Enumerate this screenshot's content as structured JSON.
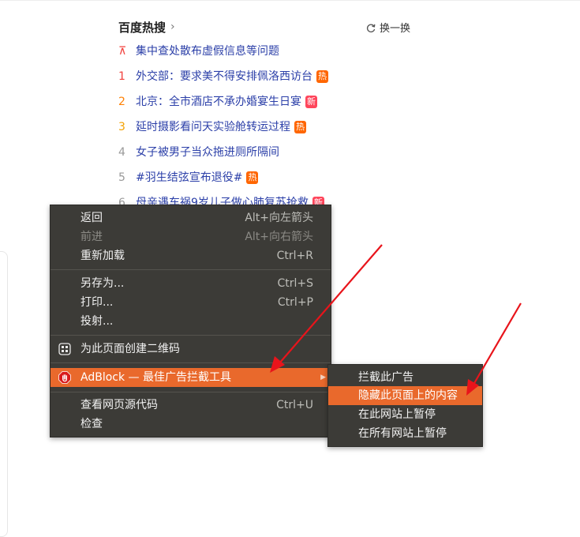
{
  "hot_search": {
    "title": "百度热搜",
    "chevron": "›",
    "refresh_label": "换一换",
    "items": [
      {
        "rank": "⊼",
        "text": "集中查处散布虚假信息等问题",
        "tag": ""
      },
      {
        "rank": "1",
        "text": "外交部：要求美不得安排佩洛西访台",
        "tag": "热"
      },
      {
        "rank": "2",
        "text": "北京：全市酒店不承办婚宴生日宴",
        "tag": "新"
      },
      {
        "rank": "3",
        "text": "延时摄影看问天实验舱转运过程",
        "tag": "热"
      },
      {
        "rank": "4",
        "text": "女子被男子当众拖进厕所隔间",
        "tag": ""
      },
      {
        "rank": "5",
        "text": "#羽生结弦宣布退役#",
        "tag": "热"
      },
      {
        "rank": "6",
        "text": "母亲遇车祸9岁儿子做心肺复苏抢救",
        "tag": "新"
      }
    ]
  },
  "context_menu": {
    "back": {
      "label": "返回",
      "shortcut": "Alt+向左箭头"
    },
    "forward": {
      "label": "前进",
      "shortcut": "Alt+向右箭头"
    },
    "reload": {
      "label": "重新加载",
      "shortcut": "Ctrl+R"
    },
    "save_as": {
      "label": "另存为...",
      "shortcut": "Ctrl+S"
    },
    "print": {
      "label": "打印...",
      "shortcut": "Ctrl+P"
    },
    "cast": {
      "label": "投射..."
    },
    "qr": {
      "label": "为此页面创建二维码"
    },
    "adblock": {
      "label": "AdBlock — 最佳广告拦截工具"
    },
    "view_source": {
      "label": "查看网页源代码",
      "shortcut": "Ctrl+U"
    },
    "inspect": {
      "label": "检查"
    }
  },
  "submenu": {
    "items": [
      "拦截此广告",
      "隐藏此页面上的内容",
      "在此网站上暂停",
      "在所有网站上暂停"
    ]
  },
  "colors": {
    "menu_bg": "#3c3b37",
    "highlight": "#e9692c",
    "arrow": "#e8141b",
    "link": "#2b3fa8"
  }
}
